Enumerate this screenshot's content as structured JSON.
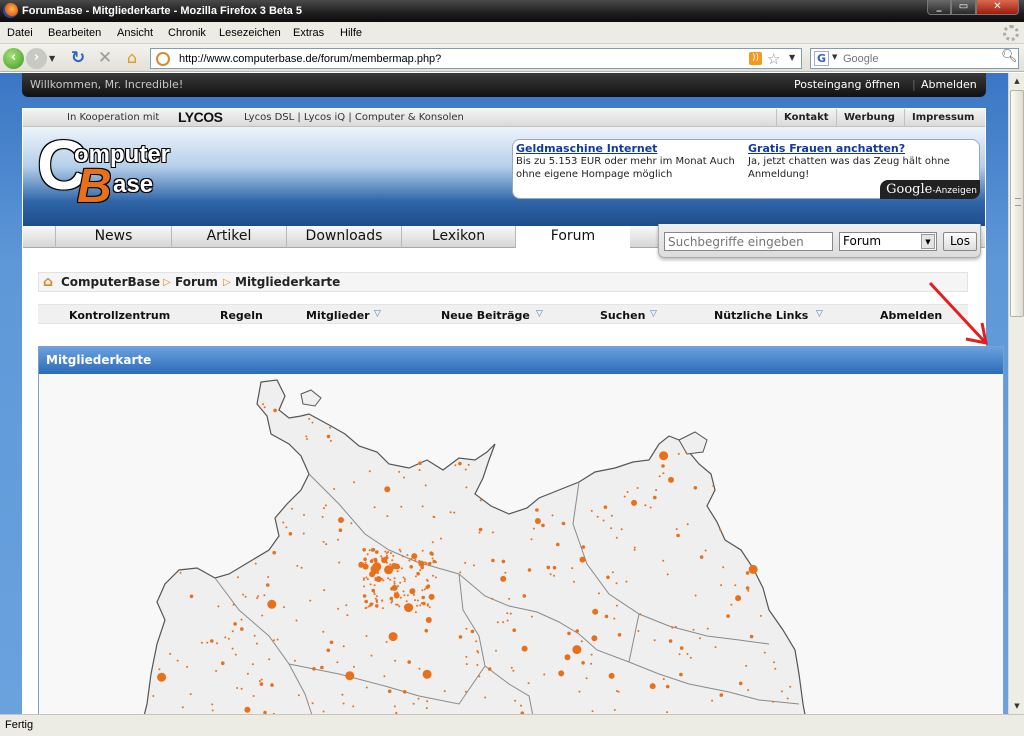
{
  "window": {
    "title": "ForumBase - Mitgliederkarte - Mozilla Firefox 3 Beta 5"
  },
  "menu": [
    "Datei",
    "Bearbeiten",
    "Ansicht",
    "Chronik",
    "Lesezeichen",
    "Extras",
    "Hilfe"
  ],
  "navbar": {
    "url": "http://www.computerbase.de/forum/membermap.php?",
    "search_placeholder": "Google",
    "search_engine_icon": "G"
  },
  "userbar": {
    "welcome": "Willkommen, Mr. Incredible!",
    "inbox": "Posteingang öffnen",
    "separator": "|",
    "logout": "Abmelden"
  },
  "partnerbar": {
    "koop": "In Kooperation mit",
    "lycos": "LYCOS",
    "links": "Lycos DSL | Lycos iQ | Computer & Konsolen",
    "right": [
      "Kontakt",
      "Werbung",
      "Impressum"
    ]
  },
  "logo": {
    "c": "C",
    "omputer": "omputer",
    "b": "B",
    "ase": "ase"
  },
  "ads": [
    {
      "title": "Geldmaschine Internet",
      "text": "Bis zu 5.153 EUR oder mehr im Monat Auch ohne eigene Hompage möglich"
    },
    {
      "title": "Gratis Frauen anchatten?",
      "text": "Ja, jetzt chatten was das Zeug hält ohne Anmeldung!"
    }
  ],
  "google_ads": {
    "brand": "Google",
    "suffix": "-Anzeigen"
  },
  "mainnav": [
    "News",
    "Artikel",
    "Downloads",
    "Lexikon",
    "Forum"
  ],
  "search": {
    "placeholder": "Suchbegriffe eingeben",
    "scope": "Forum",
    "button": "Los"
  },
  "breadcrumb": [
    "ComputerBase",
    "Forum",
    "Mitgliederkarte"
  ],
  "forumnav": [
    "Kontrollzentrum",
    "Regeln",
    "Mitglieder",
    "Neue Beiträge",
    "Suchen",
    "Nützliche Links",
    "Abmelden"
  ],
  "map": {
    "title": "Mitgliederkarte"
  },
  "status": "Fertig",
  "colors": {
    "accent": "#e8701a",
    "header_blue": "#2c6cb8",
    "marker": "#e8701a"
  }
}
